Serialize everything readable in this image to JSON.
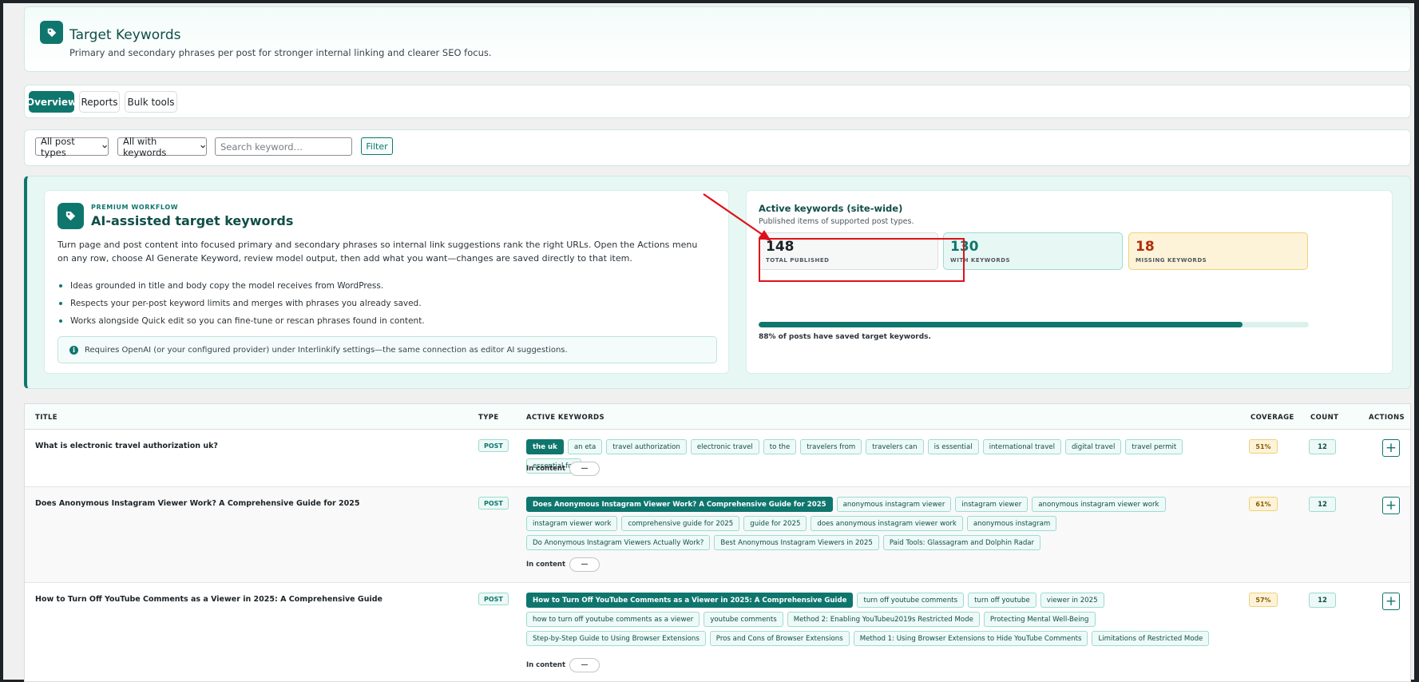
{
  "header": {
    "title": "Target Keywords",
    "subtitle": "Primary and secondary phrases per post for stronger internal linking and clearer SEO focus."
  },
  "tabs": [
    {
      "label": "Overview",
      "active": true
    },
    {
      "label": "Reports",
      "active": false
    },
    {
      "label": "Bulk tools",
      "active": false
    }
  ],
  "filters": {
    "post_type": "All post types",
    "keyword_filter": "All with keywords",
    "search_placeholder": "Search keyword…",
    "filter_label": "Filter"
  },
  "promo": {
    "eyebrow": "PREMIUM WORKFLOW",
    "title": "AI-assisted target keywords",
    "description": "Turn page and post content into focused primary and secondary phrases so internal link suggestions rank the right URLs. Open the Actions menu on any row, choose AI Generate Keyword, review model output, then add what you want—changes are saved directly to that item.",
    "bullets": [
      "Ideas grounded in title and body copy the model receives from WordPress.",
      "Respects your per-post keyword limits and merges with phrases you already saved.",
      "Works alongside Quick edit so you can fine-tune or rescan phrases found in content."
    ],
    "note": "Requires OpenAI (or your configured provider) under Interlinkify settings—the same connection as editor AI suggestions."
  },
  "stats": {
    "title": "Active keywords (site-wide)",
    "subtitle": "Published items of supported post types.",
    "total_published": "148",
    "total_published_label": "TOTAL PUBLISHED",
    "with_keywords": "130",
    "with_keywords_label": "WITH KEYWORDS",
    "missing_keywords": "18",
    "missing_keywords_label": "MISSING KEYWORDS",
    "progress_percent": 88,
    "progress_text": "88% of posts have saved target keywords."
  },
  "table": {
    "columns": {
      "title": "TITLE",
      "type": "TYPE",
      "keywords": "ACTIVE KEYWORDS",
      "coverage": "COVERAGE",
      "count": "COUNT",
      "actions": "ACTIONS"
    },
    "in_content_label": "In content",
    "in_content_value": "—",
    "rows": [
      {
        "title": "What is electronic travel authorization uk?",
        "type": "POST",
        "primary": "the uk",
        "keywords": [
          "an eta",
          "travel authorization",
          "electronic travel",
          "to the",
          "travelers from",
          "travelers can",
          "is essential",
          "international travel",
          "digital travel",
          "travel permit",
          "essential for"
        ],
        "coverage": "51%",
        "count": "12"
      },
      {
        "title": "Does Anonymous Instagram Viewer Work? A Comprehensive Guide for 2025",
        "type": "POST",
        "primary": "Does Anonymous Instagram Viewer Work? A Comprehensive Guide for 2025",
        "keywords": [
          "anonymous instagram viewer",
          "instagram viewer",
          "anonymous instagram viewer work",
          "instagram viewer work",
          "comprehensive guide for 2025",
          "guide for 2025",
          "does anonymous instagram viewer work",
          "anonymous instagram",
          "Do Anonymous Instagram Viewers Actually Work?",
          "Best Anonymous Instagram Viewers in 2025",
          "Paid Tools: Glassagram and Dolphin Radar"
        ],
        "coverage": "61%",
        "count": "12"
      },
      {
        "title": "How to Turn Off YouTube Comments as a Viewer in 2025: A Comprehensive Guide",
        "type": "POST",
        "primary": "How to Turn Off YouTube Comments as a Viewer in 2025: A Comprehensive Guide",
        "keywords": [
          "turn off youtube comments",
          "turn off youtube",
          "viewer in 2025",
          "how to turn off youtube comments as a viewer",
          "youtube comments",
          "Method 2: Enabling YouTubeu2019s Restricted Mode",
          "Protecting Mental Well-Being",
          "Step-by-Step Guide to Using Browser Extensions",
          "Pros and Cons of Browser Extensions",
          "Method 1: Using Browser Extensions to Hide YouTube Comments",
          "Limitations of Restricted Mode"
        ],
        "coverage": "57%",
        "count": "12"
      }
    ]
  },
  "colors": {
    "accent": "#0f766e",
    "highlight": "#e0101a",
    "missing": "#b32d0a"
  }
}
